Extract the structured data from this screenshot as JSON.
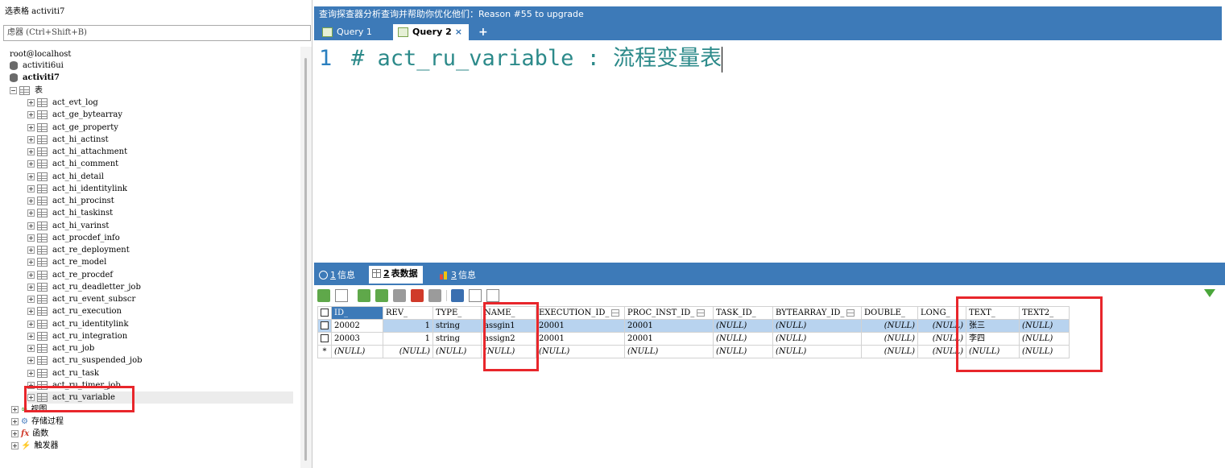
{
  "left_panel": {
    "title": "选表格 activiti7",
    "filter_placeholder": "虑器 (Ctrl+Shift+B)",
    "connection": "root@localhost",
    "databases": [
      "activiti6ui",
      "activiti7"
    ],
    "tables_folder": "表",
    "tables": [
      "act_evt_log",
      "act_ge_bytearray",
      "act_ge_property",
      "act_hi_actinst",
      "act_hi_attachment",
      "act_hi_comment",
      "act_hi_detail",
      "act_hi_identitylink",
      "act_hi_procinst",
      "act_hi_taskinst",
      "act_hi_varinst",
      "act_procdef_info",
      "act_re_deployment",
      "act_re_model",
      "act_re_procdef",
      "act_ru_deadletter_job",
      "act_ru_event_subscr",
      "act_ru_execution",
      "act_ru_identitylink",
      "act_ru_integration",
      "act_ru_job",
      "act_ru_suspended_job",
      "act_ru_task",
      "act_ru_timer_job",
      "act_ru_variable"
    ],
    "folders": [
      "视图",
      "存储过程",
      "函数",
      "触发器"
    ]
  },
  "topbar": {
    "info": "查询探查器分析查询并帮助你优化他们：Reason #55 to upgrade",
    "tabs": [
      {
        "label": "Query 1"
      },
      {
        "label": "Query 2"
      }
    ],
    "add": "+",
    "close": "×"
  },
  "editor": {
    "line_number": "1",
    "code": "# act_ru_variable : 流程变量表"
  },
  "result_tabs": [
    {
      "num": "1",
      "label": "信息"
    },
    {
      "num": "2",
      "label": "表数据"
    },
    {
      "num": "3",
      "label": "信息"
    }
  ],
  "grid": {
    "columns": [
      "ID_",
      "REV_",
      "TYPE_",
      "NAME_",
      "EXECUTION_ID_",
      "PROC_INST_ID_",
      "TASK_ID_",
      "BYTEARRAY_ID_",
      "DOUBLE_",
      "LONG_",
      "TEXT_",
      "TEXT2_"
    ],
    "rows": [
      [
        "20002",
        "1",
        "string",
        "assgin1",
        "20001",
        "20001",
        "(NULL)",
        "(NULL)",
        "(NULL)",
        "(NULL)",
        "张三",
        "(NULL)"
      ],
      [
        "20003",
        "1",
        "string",
        "assign2",
        "20001",
        "20001",
        "(NULL)",
        "(NULL)",
        "(NULL)",
        "(NULL)",
        "李四",
        "(NULL)"
      ],
      [
        "(NULL)",
        "(NULL)",
        "(NULL)",
        "(NULL)",
        "(NULL)",
        "(NULL)",
        "(NULL)",
        "(NULL)",
        "(NULL)",
        "(NULL)",
        "(NULL)",
        "(NULL)"
      ]
    ],
    "new_row_marker": "*"
  },
  "colors": {
    "accent": "#3d7ab8",
    "highlight": "#e8262b",
    "selected_row": "#b8d3ef"
  }
}
